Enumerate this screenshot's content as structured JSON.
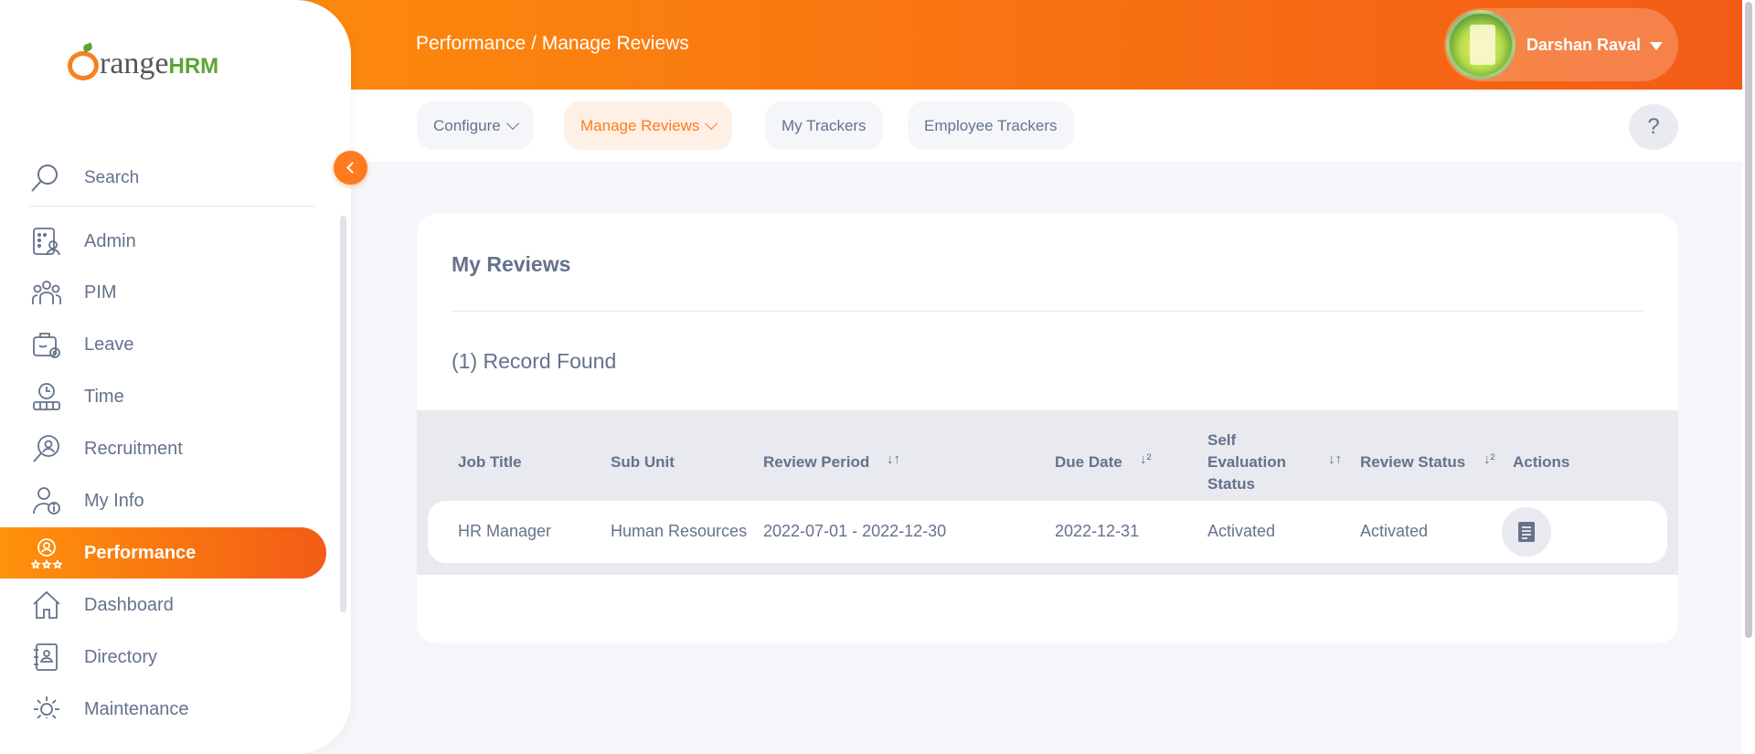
{
  "header": {
    "breadcrumb": "Performance / Manage Reviews",
    "user_name": "Darshan Raval"
  },
  "subnav": {
    "tabs": [
      {
        "label": "Configure",
        "has_dropdown": true,
        "active": false
      },
      {
        "label": "Manage Reviews",
        "has_dropdown": true,
        "active": true
      },
      {
        "label": "My Trackers",
        "has_dropdown": false,
        "active": false
      },
      {
        "label": "Employee Trackers",
        "has_dropdown": false,
        "active": false
      }
    ],
    "help_label": "?"
  },
  "sidebar": {
    "logo": {
      "brand_main": "range",
      "brand_suffix": "HRM"
    },
    "search_label": "Search",
    "items": [
      {
        "label": "Admin",
        "icon": "admin-icon"
      },
      {
        "label": "PIM",
        "icon": "pim-icon"
      },
      {
        "label": "Leave",
        "icon": "leave-icon"
      },
      {
        "label": "Time",
        "icon": "time-icon"
      },
      {
        "label": "Recruitment",
        "icon": "recruitment-icon"
      },
      {
        "label": "My Info",
        "icon": "my-info-icon"
      },
      {
        "label": "Performance",
        "icon": "performance-icon",
        "active": true
      },
      {
        "label": "Dashboard",
        "icon": "dashboard-icon"
      },
      {
        "label": "Directory",
        "icon": "directory-icon"
      },
      {
        "label": "Maintenance",
        "icon": "maintenance-icon"
      }
    ]
  },
  "main": {
    "title": "My Reviews",
    "record_count": "(1) Record Found",
    "table": {
      "headers": {
        "job_title": "Job Title",
        "sub_unit": "Sub Unit",
        "review_period": "Review Period",
        "due_date": "Due Date",
        "self_eval_line1": "Self",
        "self_eval_line2": "Evaluation",
        "self_eval_line3": "Status",
        "review_status": "Review Status",
        "actions": "Actions"
      },
      "sort_icons": {
        "updown": "↓↑",
        "az": "↓²"
      },
      "rows": [
        {
          "job_title": "HR Manager",
          "sub_unit": "Human Resources",
          "review_period": "2022-07-01 - 2022-12-30",
          "due_date": "2022-12-31",
          "self_evaluation_status": "Activated",
          "review_status": "Activated",
          "action_icon": "document-icon"
        }
      ]
    }
  },
  "colors": {
    "brand_orange": "#ff7b1d",
    "gradient_start": "#ff920b",
    "gradient_end": "#f35c17",
    "text": "#64728c",
    "logo_green": "#5aa531"
  }
}
